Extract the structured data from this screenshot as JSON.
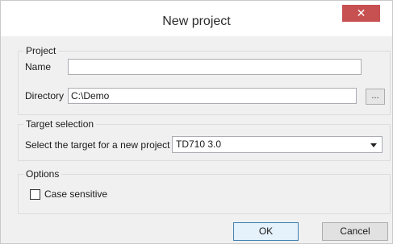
{
  "window": {
    "title": "New project",
    "close_glyph": "✕"
  },
  "project_group": {
    "legend": "Project",
    "name_label": "Name",
    "name_value": "",
    "directory_label": "Directory",
    "directory_value": "C:\\Demo",
    "browse_label": "..."
  },
  "target_group": {
    "legend": "Target selection",
    "select_label": "Select the target for a new project",
    "selected_value": "TD710 3.0"
  },
  "options_group": {
    "legend": "Options",
    "case_sensitive_label": "Case sensitive",
    "case_sensitive_checked": false
  },
  "buttons": {
    "ok": "OK",
    "cancel": "Cancel"
  },
  "colors": {
    "close_button": "#c75050",
    "default_button_border": "#3c7fb1"
  }
}
